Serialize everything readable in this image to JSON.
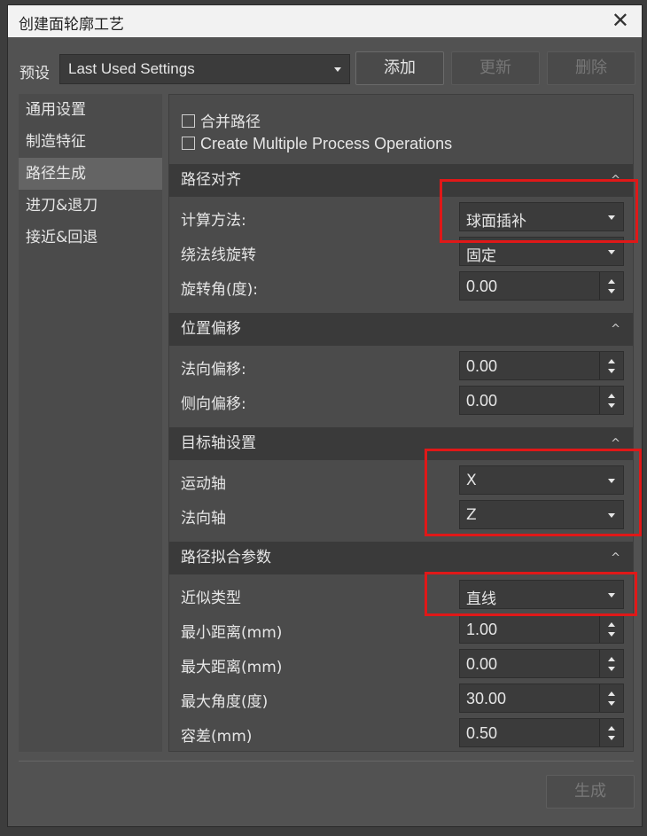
{
  "window": {
    "title": "创建面轮廓工艺"
  },
  "preset": {
    "label": "预设",
    "value": "Last Used Settings"
  },
  "buttons": {
    "add": "添加",
    "update": "更新",
    "delete": "删除",
    "generate": "生成"
  },
  "sidebar": {
    "items": [
      {
        "label": "通用设置"
      },
      {
        "label": "制造特征"
      },
      {
        "label": "路径生成",
        "active": true
      },
      {
        "label": "进刀&退刀"
      },
      {
        "label": "接近&回退"
      }
    ]
  },
  "options": {
    "merge_paths": {
      "label": "合并路径",
      "checked": false
    },
    "multi_ops": {
      "label": "Create Multiple Process Operations",
      "checked": false
    }
  },
  "sections": {
    "path_align": {
      "title": "路径对齐",
      "calc_method": {
        "label": "计算方法:",
        "value": "球面插补"
      },
      "normal_rotation": {
        "label": "绕法线旋转",
        "value": "固定"
      },
      "rotation_angle": {
        "label": "旋转角(度):",
        "value": "0.00"
      }
    },
    "position_offset": {
      "title": "位置偏移",
      "normal_offset": {
        "label": "法向偏移:",
        "value": "0.00"
      },
      "side_offset": {
        "label": "侧向偏移:",
        "value": "0.00"
      }
    },
    "target_axis": {
      "title": "目标轴设置",
      "motion_axis": {
        "label": "运动轴",
        "value": "X"
      },
      "normal_axis": {
        "label": "法向轴",
        "value": "Z"
      }
    },
    "path_fit": {
      "title": "路径拟合参数",
      "approx_type": {
        "label": "近似类型",
        "value": "直线"
      },
      "min_distance": {
        "label": "最小距离(mm)",
        "value": "1.00"
      },
      "max_distance": {
        "label": "最大距离(mm)",
        "value": "0.00"
      },
      "max_angle": {
        "label": "最大角度(度)",
        "value": "30.00"
      },
      "tolerance": {
        "label": "容差(mm)",
        "value": "0.50"
      }
    }
  },
  "colors": {
    "highlight": "#e01818",
    "panel": "#4b4b4b",
    "header": "#3a3a3a"
  }
}
